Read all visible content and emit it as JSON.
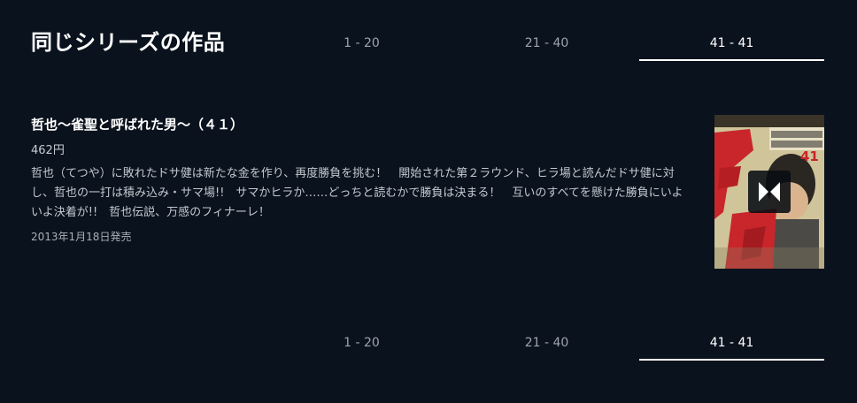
{
  "section": {
    "title": "同じシリーズの作品"
  },
  "pager": {
    "tabs": [
      {
        "label": "1 - 20",
        "active": false
      },
      {
        "label": "21 - 40",
        "active": false
      },
      {
        "label": "41 - 41",
        "active": true
      }
    ]
  },
  "item": {
    "title": "哲也～雀聖と呼ばれた男～（４１）",
    "price": "462円",
    "description": "哲也（てつや）に敗れたドサ健は新たな金を作り、再度勝負を挑む！　開始された第２ラウンド、ヒラ場と読んだドサ健に対し、哲也の一打は積み込み・サマ場!!　サマかヒラか……どっちと読むかで勝負は決まる！　互いのすべてを懸けた勝負にいよいよ決着が!!　哲也伝説、万感のフィナーレ！",
    "release_date": "2013年1月18日発売",
    "cover": {
      "volume_number": "41",
      "badge_icon": "unext-logo-icon"
    }
  },
  "colors": {
    "background": "#0a121d",
    "active_tab": "#ffffff",
    "inactive_tab": "#9ea4ad"
  }
}
